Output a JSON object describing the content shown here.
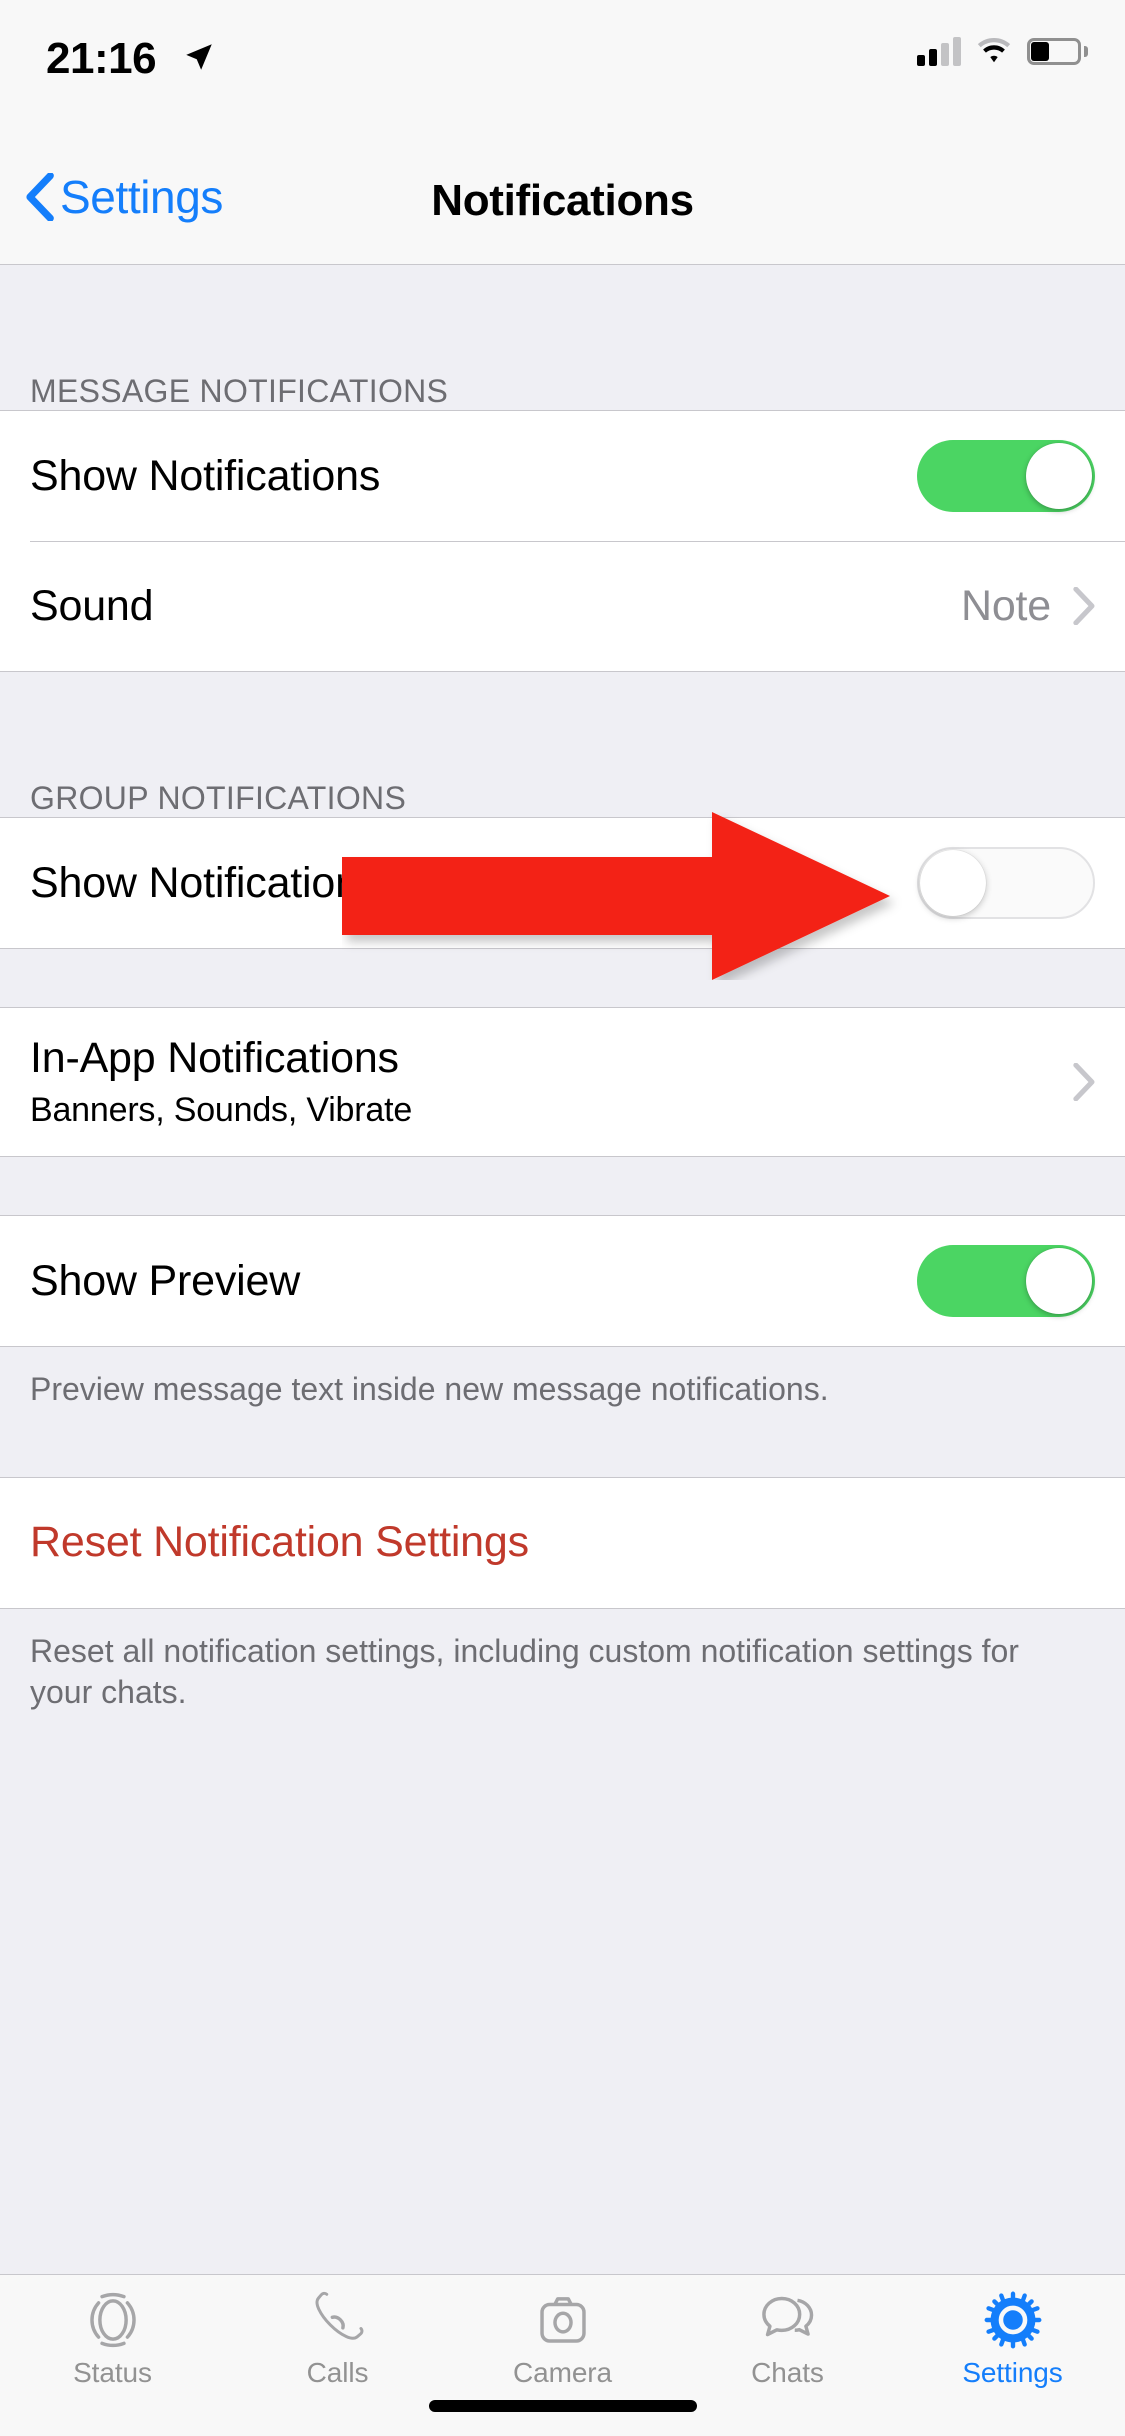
{
  "status_bar": {
    "time": "21:16",
    "location_icon": "location-arrow-icon",
    "signal_icon": "cellular-signal-icon",
    "signal_bars_filled": 2,
    "signal_bars_total": 4,
    "wifi_icon": "wifi-icon",
    "battery_icon": "battery-icon",
    "battery_level_percent": 40
  },
  "nav": {
    "back_label": "Settings",
    "back_icon": "chevron-left-icon",
    "title": "Notifications"
  },
  "sections": [
    {
      "header": "MESSAGE NOTIFICATIONS",
      "rows": [
        {
          "label": "Show Notifications",
          "control": "toggle",
          "value": "on"
        },
        {
          "label": "Sound",
          "control": "disclosure",
          "value": "Note"
        }
      ]
    },
    {
      "header": "GROUP NOTIFICATIONS",
      "rows": [
        {
          "label": "Show Notifications",
          "control": "toggle",
          "value": "off"
        }
      ]
    },
    {
      "header": "",
      "rows": [
        {
          "label": "In-App Notifications",
          "sub": "Banners, Sounds, Vibrate",
          "control": "disclosure",
          "value": ""
        }
      ]
    },
    {
      "header": "",
      "footer": "Preview message text inside new message notifications.",
      "rows": [
        {
          "label": "Show Preview",
          "control": "toggle",
          "value": "on"
        }
      ]
    },
    {
      "header": "",
      "footer": "Reset all notification settings, including custom notification settings for your chats.",
      "rows": [
        {
          "label": "Reset Notification Settings",
          "control": "none",
          "value": "",
          "destructive": true
        }
      ]
    }
  ],
  "annotation": {
    "type": "arrow",
    "direction": "right",
    "color": "#F32013",
    "points_at": "group-notifications-show-notifications-toggle"
  },
  "tab_bar": {
    "items": [
      {
        "label": "Status",
        "icon": "status-rings-icon",
        "active": false
      },
      {
        "label": "Calls",
        "icon": "phone-icon",
        "active": false
      },
      {
        "label": "Camera",
        "icon": "camera-icon",
        "active": false
      },
      {
        "label": "Chats",
        "icon": "chat-bubbles-icon",
        "active": false
      },
      {
        "label": "Settings",
        "icon": "gear-icon",
        "active": true
      }
    ]
  },
  "colors": {
    "accent_blue": "#147EFB",
    "toggle_on_green": "#4BD563",
    "destructive_red": "#C0392B",
    "annotation_red": "#F32013",
    "group_background": "#EFEFF4",
    "row_background": "#FFFFFF",
    "separator": "#C8C7CC",
    "secondary_text": "#8E8E93",
    "header_text": "#6D6D72"
  },
  "home_indicator": "home-indicator"
}
